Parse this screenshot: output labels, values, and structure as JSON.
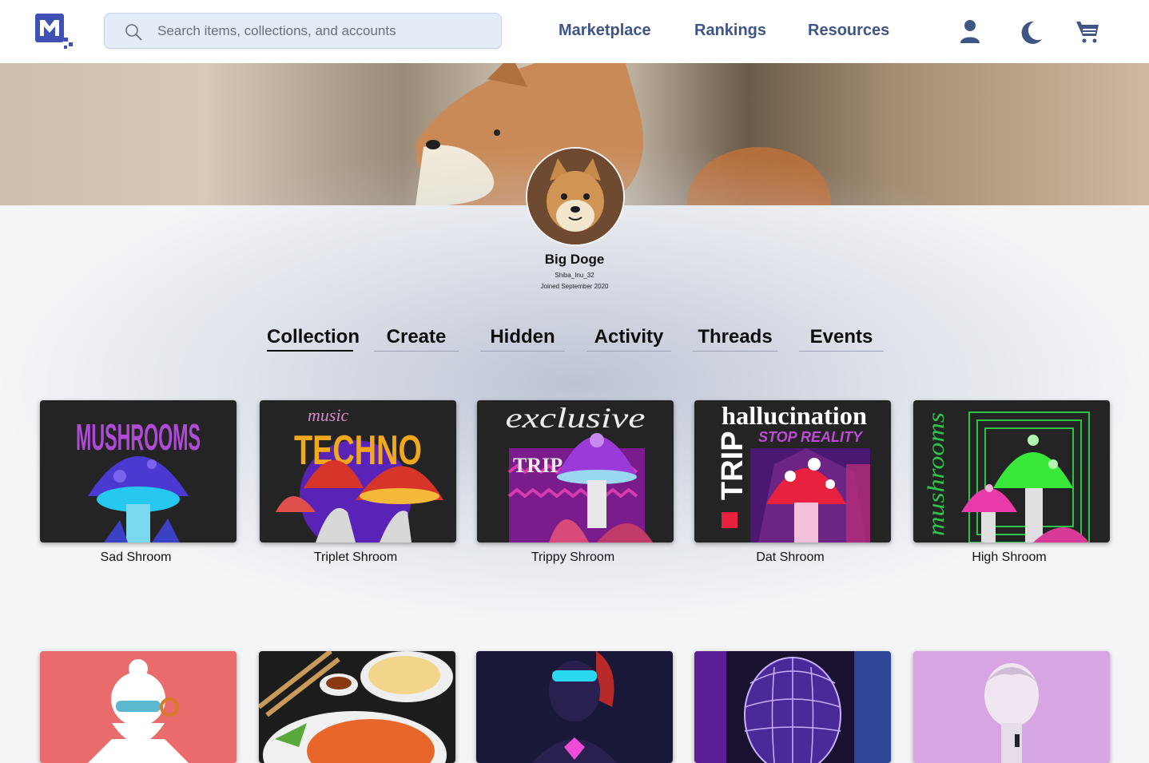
{
  "search": {
    "placeholder": "Search items, collections, and accounts"
  },
  "nav": {
    "marketplace": "Marketplace",
    "rankings": "Rankings",
    "resources": "Resources"
  },
  "icons": {
    "account": "user-icon",
    "theme": "moon-icon",
    "cart": "cart-icon",
    "search": "search-icon"
  },
  "colors": {
    "nav": "#3e5586",
    "brand": "#3f51b5"
  },
  "profile": {
    "name": "Big Doge",
    "handle": "Shiba_Inu_32",
    "joined": "Joined September 2020"
  },
  "tabs": [
    "Collection",
    "Create",
    "Hidden",
    "Activity",
    "Threads",
    "Events"
  ],
  "active_tab": "Collection",
  "items": [
    {
      "name": "Sad Shroom",
      "art_text": "MUSHROOMS"
    },
    {
      "name": "Triplet Shroom",
      "art_text": [
        "music",
        "TECHNO"
      ]
    },
    {
      "name": "Trippy Shroom",
      "art_text": [
        "exclusive",
        "TRIP"
      ]
    },
    {
      "name": "Dat Shroom",
      "art_text": [
        "hallucination",
        "STOP REALITY",
        "TRIP"
      ]
    },
    {
      "name": "High Shroom",
      "art_text": "mushrooms"
    }
  ]
}
